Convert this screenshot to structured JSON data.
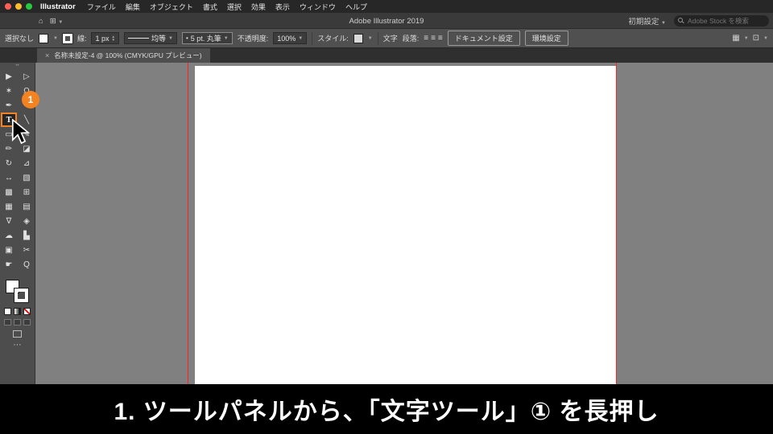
{
  "menu_bar": {
    "app_name": "Illustrator",
    "items": [
      "ファイル",
      "編集",
      "オブジェクト",
      "書式",
      "選択",
      "効果",
      "表示",
      "ウィンドウ",
      "ヘルプ"
    ]
  },
  "title_bar": {
    "title": "Adobe Illustrator 2019",
    "workspace": "初期設定",
    "search_placeholder": "Adobe Stock を検索"
  },
  "control_bar": {
    "selection_label": "選択なし",
    "stroke_label": "線:",
    "stroke_width_value": "1 px",
    "profile_value": "均等",
    "brush_value": "5 pt. 丸筆",
    "opacity_label": "不透明度:",
    "opacity_value": "100%",
    "style_label": "スタイル:",
    "char_label": "文字",
    "paragraph_label": "段落:",
    "document_setup_label": "ドキュメント設定",
    "preferences_label": "環境設定"
  },
  "doc_tab": {
    "close_label": "×",
    "title": "名称未設定-4 @ 100% (CMYK/GPU プレビュー)"
  },
  "toolbar": {
    "badge_number": "1",
    "tools": [
      {
        "name": "selection-tool",
        "glyph": "▶"
      },
      {
        "name": "direct-selection-tool",
        "glyph": "▷"
      },
      {
        "name": "magic-wand-tool",
        "glyph": "✶"
      },
      {
        "name": "lasso-tool",
        "glyph": "Ω"
      },
      {
        "name": "pen-tool",
        "glyph": "✒"
      },
      {
        "name": "curvature-tool",
        "glyph": "∿"
      },
      {
        "name": "type-tool",
        "glyph": "T",
        "active": true
      },
      {
        "name": "line-segment-tool",
        "glyph": "╲"
      },
      {
        "name": "rectangle-tool",
        "glyph": "▭"
      },
      {
        "name": "paintbrush-tool",
        "glyph": "✎"
      },
      {
        "name": "pencil-tool",
        "glyph": "✏"
      },
      {
        "name": "eraser-tool",
        "glyph": "◪"
      },
      {
        "name": "rotate-tool",
        "glyph": "↻"
      },
      {
        "name": "scale-tool",
        "glyph": "⊿"
      },
      {
        "name": "width-tool",
        "glyph": "↔"
      },
      {
        "name": "free-transform-tool",
        "glyph": "▧"
      },
      {
        "name": "shape-builder-tool",
        "glyph": "▩"
      },
      {
        "name": "perspective-grid-tool",
        "glyph": "⊞"
      },
      {
        "name": "mesh-tool",
        "glyph": "▦"
      },
      {
        "name": "gradient-tool",
        "glyph": "▤"
      },
      {
        "name": "eyedropper-tool",
        "glyph": "∇"
      },
      {
        "name": "blend-tool",
        "glyph": "◈"
      },
      {
        "name": "symbol-sprayer-tool",
        "glyph": "☁"
      },
      {
        "name": "graph-tool",
        "glyph": "▙"
      },
      {
        "name": "artboard-tool",
        "glyph": "▣"
      },
      {
        "name": "slice-tool",
        "glyph": "✂"
      },
      {
        "name": "hand-tool",
        "glyph": "☛"
      },
      {
        "name": "zoom-tool",
        "glyph": "Q"
      }
    ]
  },
  "caption": {
    "text": "1. ツールパネルから、「文字ツール」① を長押し"
  },
  "colors": {
    "accent_orange": "#F58220",
    "guide_red": "#FF2020",
    "artboard_white": "#FFFFFF",
    "pasteboard_gray": "#808080"
  }
}
